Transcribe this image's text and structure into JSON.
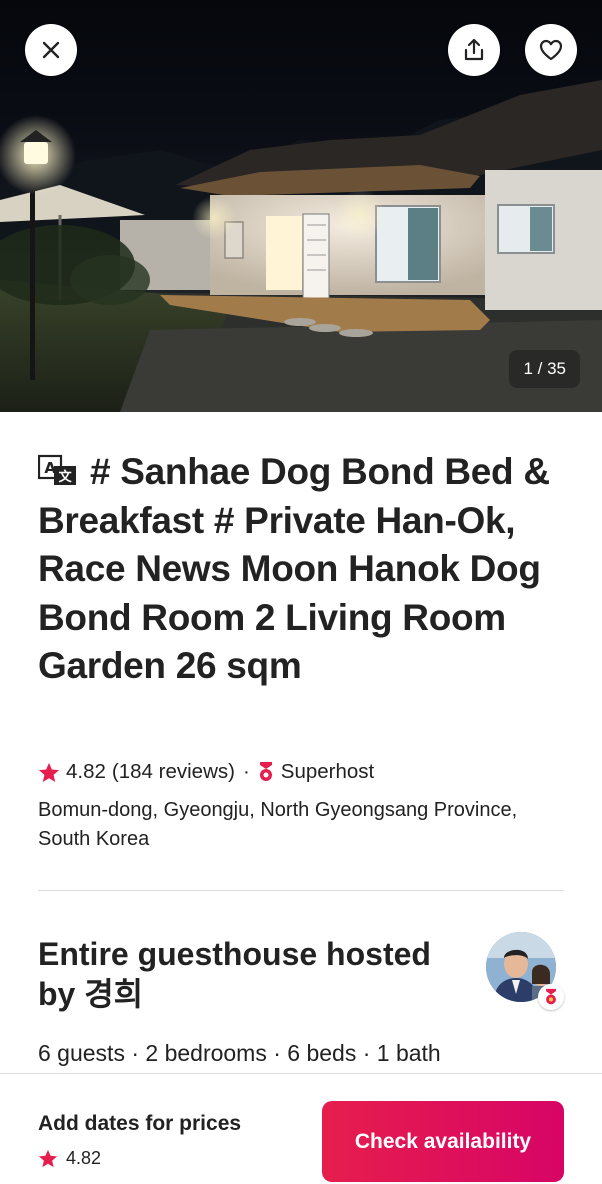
{
  "photo": {
    "counter": "1 / 35",
    "current_index": 1,
    "total": 35
  },
  "listing": {
    "title": "# Sanhae Dog Bond Bed & Breakfast # Private Han-Ok, Race News Moon Hanok Dog Bond Room 2 Living Room Garden 26 sqm",
    "rating": "4.82",
    "reviews": "(184 reviews)",
    "separator": "·",
    "superhost": "Superhost",
    "location": "Bomun-dong, Gyeongju, North Gyeongsang Province, South Korea"
  },
  "host": {
    "title": "Entire guesthouse hosted by 경희"
  },
  "facts": "6 guests · 2 bedrooms · 6 beds · 1 bath",
  "footer": {
    "price_label": "Add dates for prices",
    "rating": "4.82",
    "cta_label": "Check availability"
  },
  "icons": {
    "close": "close-icon",
    "share": "share-icon",
    "favorite": "heart-icon",
    "translate": "translate-icon",
    "star": "star-icon",
    "superhost": "superhost-medal-icon"
  },
  "colors": {
    "brand": "#e61e4d",
    "brand_end": "#d70466",
    "text": "#222222",
    "divider": "#dddddd"
  }
}
